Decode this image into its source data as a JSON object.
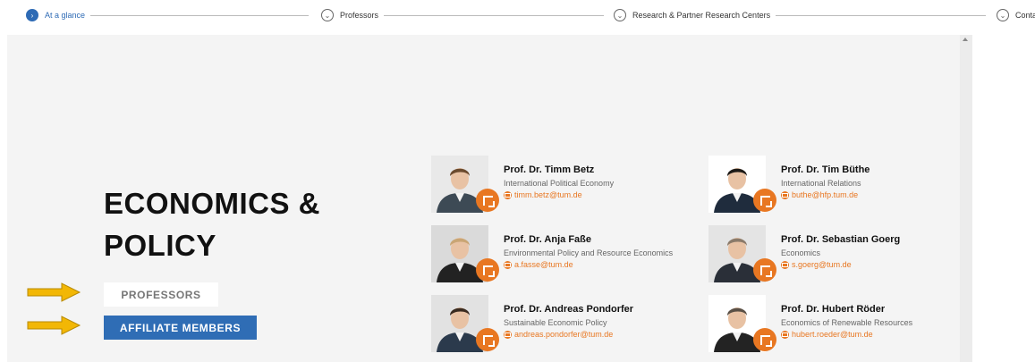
{
  "nav": {
    "steps": [
      {
        "label": "At a glance",
        "active": true
      },
      {
        "label": "Professors",
        "active": false
      },
      {
        "label": "Research & Partner Research Centers",
        "active": false
      },
      {
        "label": "Contac",
        "active": false
      }
    ]
  },
  "section": {
    "title_line1": "ECONOMICS &",
    "title_line2": "POLICY"
  },
  "buttons": {
    "professors": "PROFESSORS",
    "affiliate": "AFFILIATE MEMBERS"
  },
  "colors": {
    "accent_orange": "#e87722",
    "brand_blue": "#2f6db5",
    "arrow_yellow": "#f2b705"
  },
  "people": [
    {
      "name": "Prof. Dr. Timm Betz",
      "field": "International Political Economy",
      "email": "timm.betz@tum.de",
      "bg": "#e9e9e9",
      "shirt": "#3d4a55",
      "hair": "#6a4a2e"
    },
    {
      "name": "Prof. Dr. Tim Büthe",
      "field": "International Relations",
      "email": "buthe@hfp.tum.de",
      "bg": "#ffffff",
      "shirt": "#1f2c3d",
      "hair": "#1d1a17"
    },
    {
      "name": "Prof. Dr. Anja Faße",
      "field": "Environmental Policy and Resource Economics",
      "email": "a.fasse@tum.de",
      "bg": "#dadada",
      "shirt": "#222222",
      "hair": "#c9a574"
    },
    {
      "name": "Prof. Dr. Sebastian Goerg",
      "field": "Economics",
      "email": "s.goerg@tum.de",
      "bg": "#e4e4e4",
      "shirt": "#2a2f38",
      "hair": "#8a7a6a"
    },
    {
      "name": "Prof. Dr. Andreas Pondorfer",
      "field": "Sustainable Economic Policy",
      "email": "andreas.pondorfer@tum.de",
      "bg": "#e2e2e2",
      "shirt": "#2b3a4c",
      "hair": "#3a2b20"
    },
    {
      "name": "Prof. Dr. Hubert Röder",
      "field": "Economics of Renewable Resources",
      "email": "hubert.roeder@tum.de",
      "bg": "#ffffff",
      "shirt": "#232323",
      "hair": "#5a5046"
    }
  ]
}
